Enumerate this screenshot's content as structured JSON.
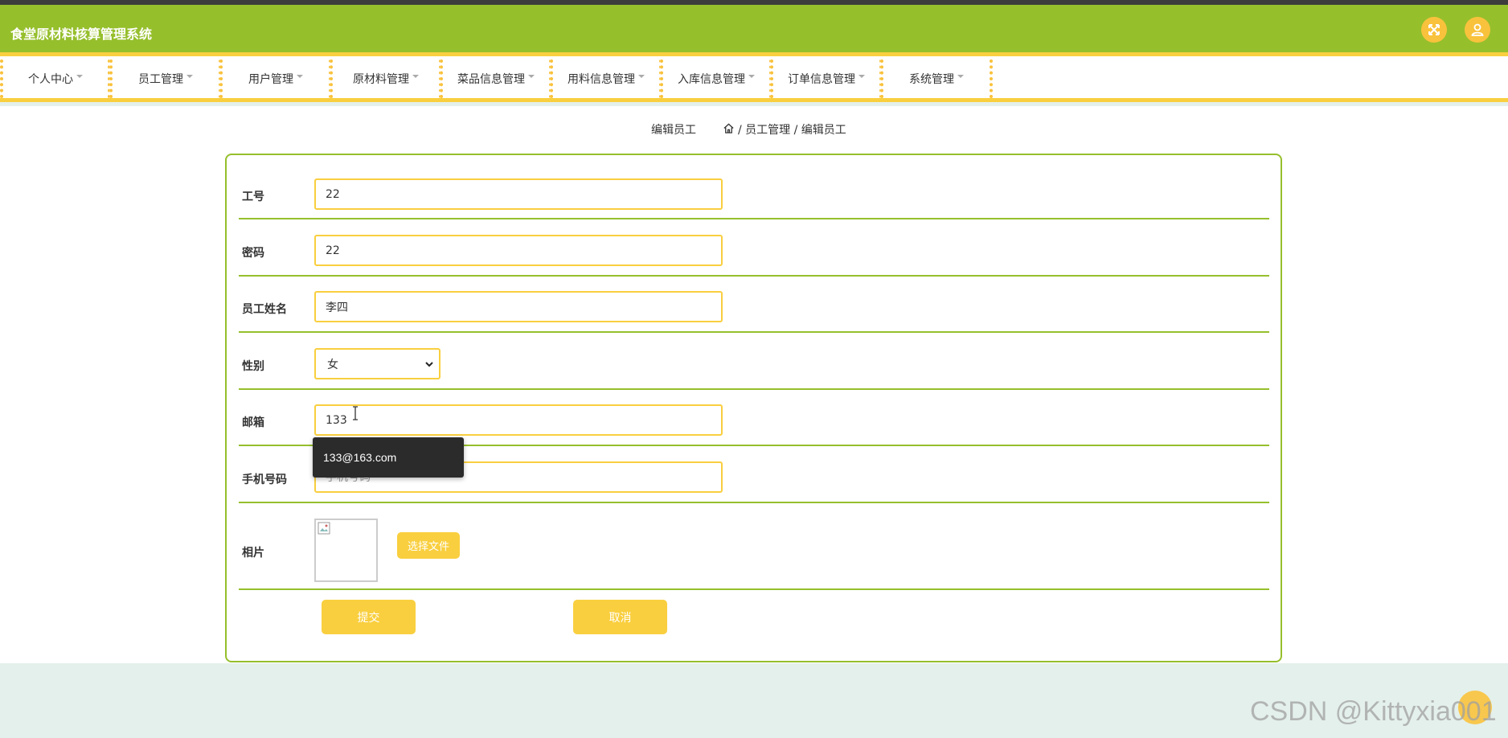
{
  "app": {
    "title": "食堂原材料核算管理系统"
  },
  "header": {
    "fullscreen_icon": "fullscreen-icon",
    "user_icon": "user-icon"
  },
  "nav": {
    "items": [
      {
        "label": "个人中心"
      },
      {
        "label": "员工管理"
      },
      {
        "label": "用户管理"
      },
      {
        "label": "原材料管理"
      },
      {
        "label": "菜品信息管理"
      },
      {
        "label": "用料信息管理"
      },
      {
        "label": "入库信息管理"
      },
      {
        "label": "订单信息管理"
      },
      {
        "label": "系统管理"
      }
    ]
  },
  "breadcrumb": {
    "title": "编辑员工",
    "path": "/ 员工管理 / 编辑员工"
  },
  "form": {
    "employee_no": {
      "label": "工号",
      "value": "22"
    },
    "password": {
      "label": "密码",
      "value": "22"
    },
    "name": {
      "label": "员工姓名",
      "value": "李四"
    },
    "gender": {
      "label": "性别",
      "value": "女"
    },
    "email": {
      "label": "邮箱",
      "value": "133"
    },
    "phone": {
      "label": "手机号码",
      "value": "",
      "placeholder": "手机号码"
    },
    "photo": {
      "label": "相片",
      "choose_label": "选择文件"
    },
    "submit_label": "提交",
    "cancel_label": "取消"
  },
  "autocomplete": {
    "suggestion": "133@163.com"
  },
  "watermark": "CSDN @Kittyxia001",
  "colors": {
    "primary_green": "#96bf2c",
    "accent_yellow": "#f9cf3f",
    "footer_bg": "#e4f0eb"
  }
}
